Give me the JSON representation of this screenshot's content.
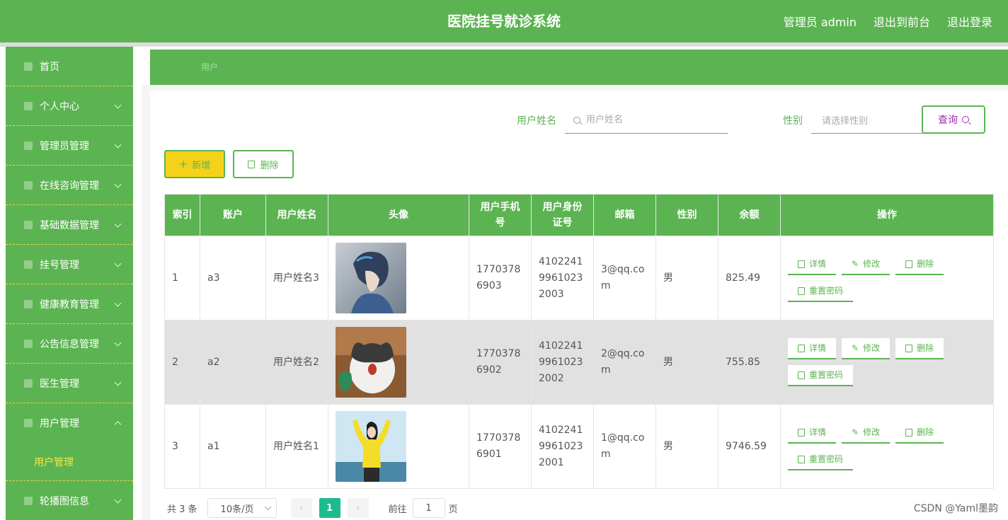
{
  "header": {
    "title": "医院挂号就诊系统",
    "user": "管理员 admin",
    "to_front": "退出到前台",
    "logout": "退出登录"
  },
  "sidebar": {
    "items": [
      {
        "label": "首页",
        "icon": "home-icon"
      },
      {
        "label": "个人中心",
        "icon": "user-icon"
      },
      {
        "label": "管理员管理",
        "icon": "admin-icon"
      },
      {
        "label": "在线咨询管理",
        "icon": "grid-icon"
      },
      {
        "label": "基础数据管理",
        "icon": "data-icon"
      },
      {
        "label": "挂号管理",
        "icon": "chart-icon"
      },
      {
        "label": "健康教育管理",
        "icon": "book-icon"
      },
      {
        "label": "公告信息管理",
        "icon": "notice-icon"
      },
      {
        "label": "医生管理",
        "icon": "doctor-icon"
      },
      {
        "label": "用户管理",
        "icon": "list-icon",
        "expanded": true
      },
      {
        "label": "轮播图信息",
        "icon": "image-icon"
      }
    ],
    "submenu_active": "用户管理"
  },
  "breadcrumb": "用户",
  "search": {
    "name_label": "用户姓名",
    "name_placeholder": "用户姓名",
    "gender_label": "性别",
    "gender_placeholder": "请选择性别",
    "query_button": "查询"
  },
  "actions": {
    "add": "新增",
    "delete": "删除"
  },
  "table": {
    "headers": [
      "索引",
      "账户",
      "用户姓名",
      "头像",
      "用户手机号",
      "用户身份证号",
      "邮箱",
      "性别",
      "余额",
      "操作"
    ],
    "rows": [
      {
        "index": "1",
        "account": "a3",
        "name": "用户姓名3",
        "phone": "17703786903",
        "id_card": "410224199610232003",
        "email": "3@qq.com",
        "gender": "男",
        "balance": "825.49"
      },
      {
        "index": "2",
        "account": "a2",
        "name": "用户姓名2",
        "phone": "17703786902",
        "id_card": "410224199610232002",
        "email": "2@qq.com",
        "gender": "男",
        "balance": "755.85"
      },
      {
        "index": "3",
        "account": "a1",
        "name": "用户姓名1",
        "phone": "17703786901",
        "id_card": "410224199610232001",
        "email": "1@qq.com",
        "gender": "男",
        "balance": "9746.59"
      }
    ],
    "ops": {
      "detail": "详情",
      "edit": "修改",
      "delete": "删除",
      "reset": "重置密码"
    }
  },
  "pagination": {
    "total": "共 3 条",
    "page_size": "10条/页",
    "current": "1",
    "goto_prefix": "前往",
    "goto_value": "1",
    "goto_suffix": "页"
  },
  "watermark": "CSDN @Yaml墨韵",
  "colors": {
    "primary": "#5bb451",
    "accent_yellow": "#f5d21a",
    "pager_active": "#1dbb8d"
  }
}
